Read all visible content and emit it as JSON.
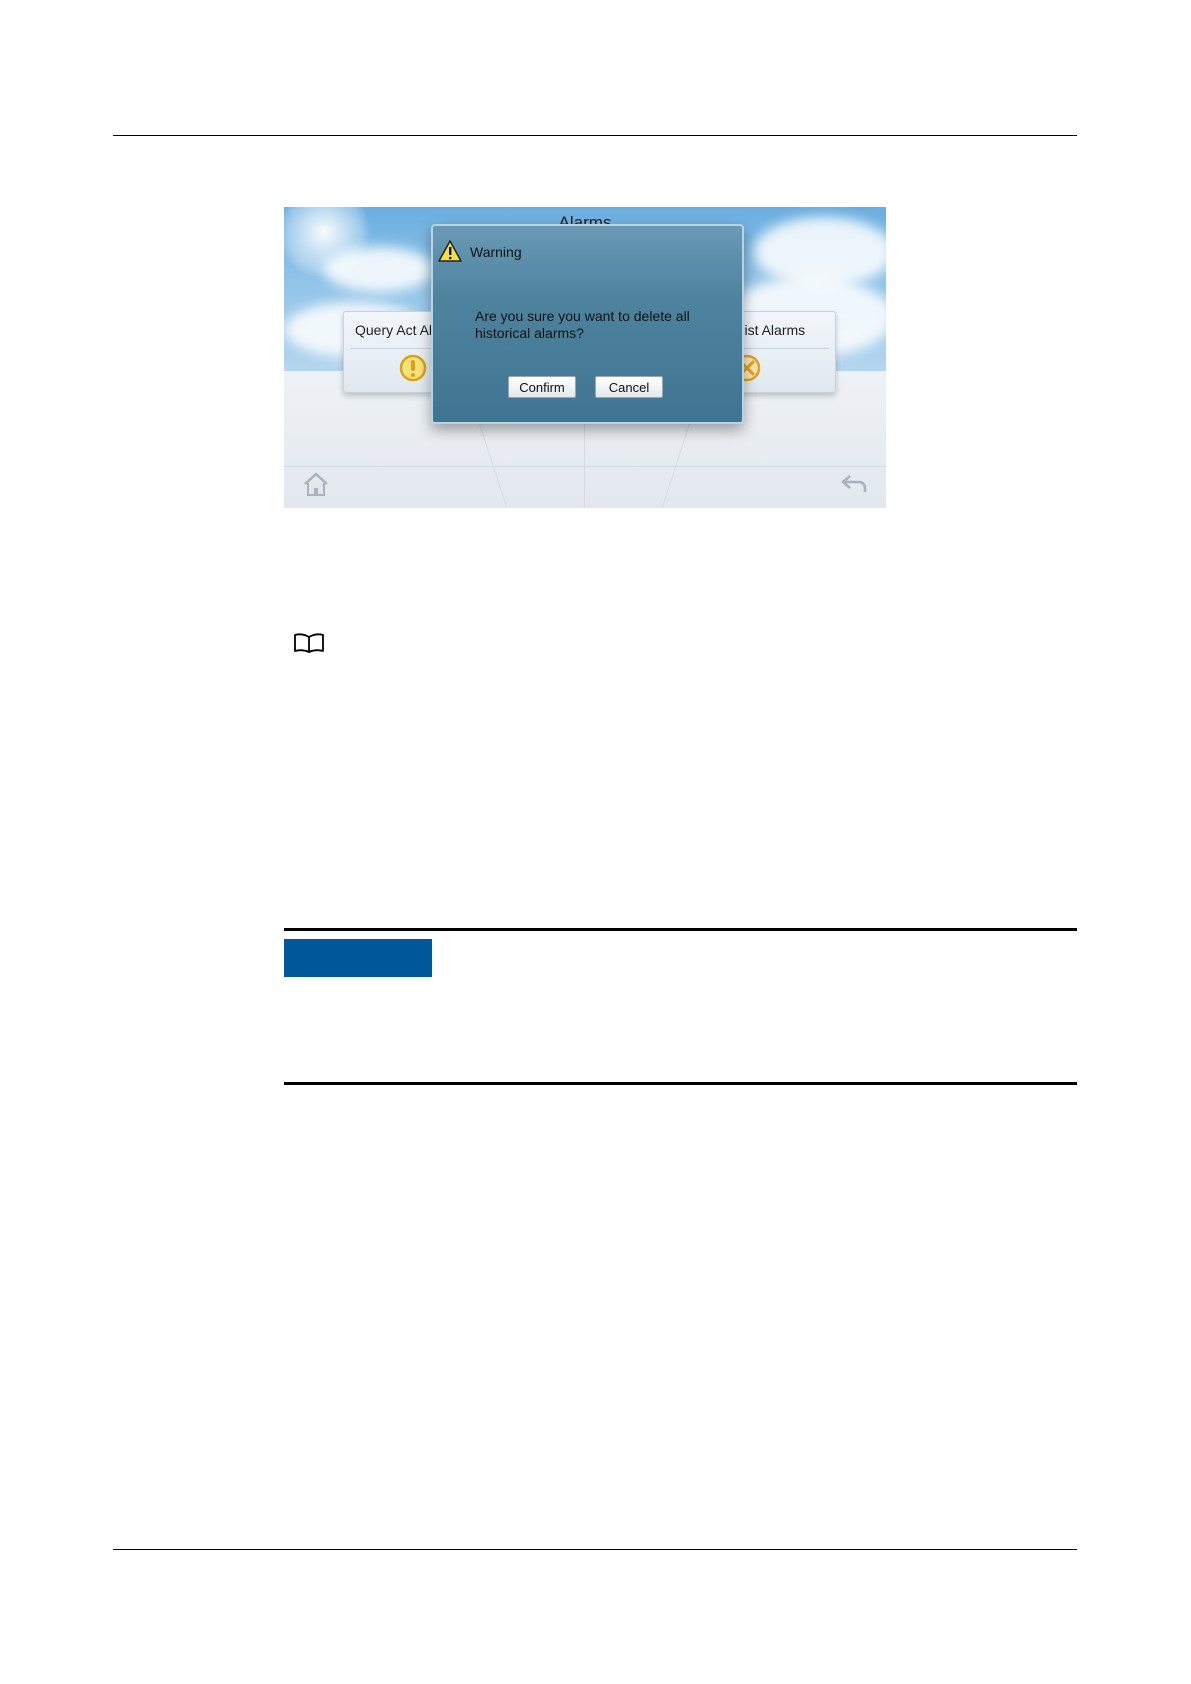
{
  "screen": {
    "title": "Alarms",
    "menu": [
      {
        "label": "Query Act Alarms",
        "icon": "alarm-warning-icon"
      },
      {
        "label": "Delete Hist Alarms",
        "icon": "delete-x-icon"
      }
    ],
    "nav": {
      "home_icon": "home-icon",
      "back_icon": "back-arrow-icon"
    }
  },
  "dialog": {
    "title": "Warning",
    "icon": "warning-triangle-icon",
    "message": "Are you sure you want to delete all historical alarms?",
    "confirm_label": "Confirm",
    "cancel_label": "Cancel"
  },
  "note": {
    "icon": "book-icon"
  },
  "colors": {
    "notice_badge": "#00589a",
    "dialog_bg": "#4f849f"
  }
}
